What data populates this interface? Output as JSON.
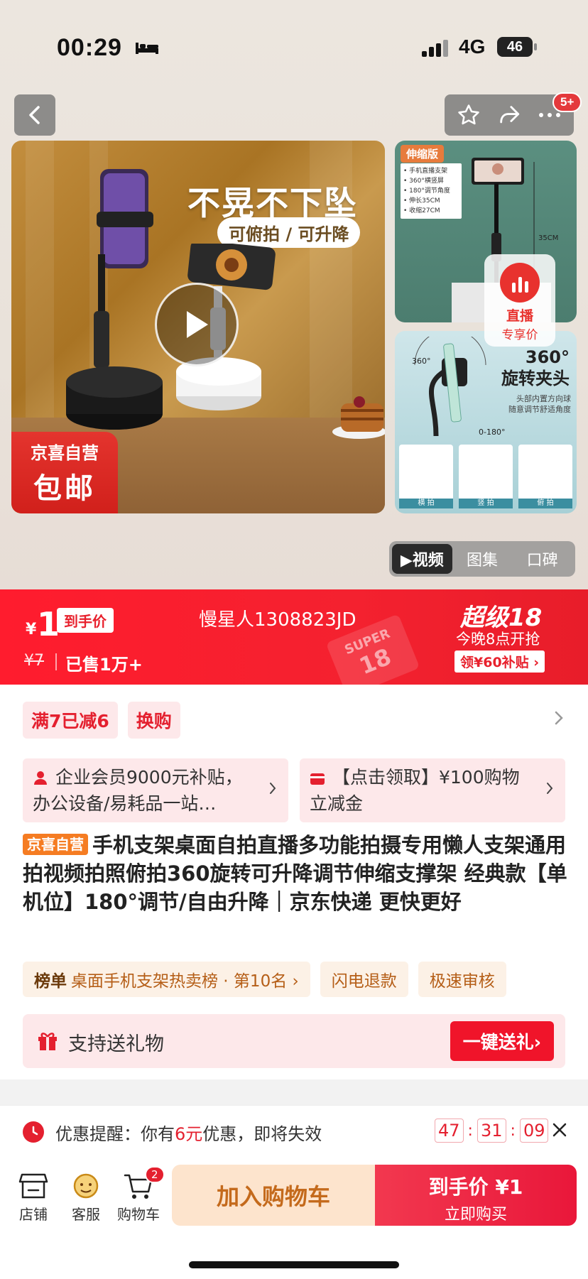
{
  "status_bar": {
    "time": "00:29",
    "network": "4G",
    "battery": "46"
  },
  "nav": {
    "badge": "5+"
  },
  "main_image": {
    "headline": "不晃不下坠",
    "subline": "可俯拍 / 可升降",
    "promo_line1": "京喜自营",
    "promo_line2": "包邮"
  },
  "thumb1": {
    "tag": "伸缩版",
    "specs": [
      "• 手机直播支架",
      "• 360°横竖屏",
      "• 180°调节角度",
      "• 伸长35CM",
      "• 收缩27CM"
    ],
    "height_label": "35CM"
  },
  "thumb2": {
    "title_line1": "360°",
    "title_line2": "旋转夹头",
    "desc_line1": "头部内置方向球",
    "desc_line2": "随意调节舒适角度",
    "angle_a": "360°",
    "angle_b": "0-180°",
    "captions": [
      "横 拍",
      "竖 拍",
      "俯 拍"
    ]
  },
  "live_chip": {
    "line1": "直播",
    "line2": "专享价"
  },
  "media_tabs": [
    {
      "label": "▶视频",
      "active": true
    },
    {
      "label": "图集",
      "active": false
    },
    {
      "label": "口碑",
      "active": false
    }
  ],
  "price": {
    "currency": "¥",
    "amount": "1",
    "final_tag": "到手价",
    "original": "¥7",
    "sold": "已售1万+",
    "store": "慢星人1308823JD",
    "super_text": "SUPER",
    "super_num": "18",
    "event_title": "超级18",
    "event_time": "今晚8点开抢",
    "subsidy": "领¥60补贴 ›"
  },
  "promos": [
    "满7已减6",
    "换购"
  ],
  "coupons": [
    {
      "text": "企业会员9000元补贴，办公设备/易耗品一站…"
    },
    {
      "text": "【点击领取】¥100购物立减金"
    }
  ],
  "product": {
    "self_tag": "京喜自营",
    "title": "手机支架桌面自拍直播多功能拍摄专用懒人支架通用拍视频拍照俯拍360旋转可升降调节伸缩支撑架 经典款【单机位】180°调节/自由升降｜京东快递 更快更好"
  },
  "rank": {
    "label": "榜单",
    "text": "桌面手机支架热卖榜 · 第10名 ›",
    "chips": [
      "闪电退款",
      "极速审核"
    ]
  },
  "gift": {
    "label": "支持送礼物",
    "button": "一键送礼›"
  },
  "reminder": {
    "prefix": "优惠提醒：你有",
    "amount": "6元",
    "suffix": "优惠，即将失效",
    "countdown": [
      "47",
      "31",
      "09"
    ]
  },
  "bottom_bar": {
    "shop": "店铺",
    "service": "客服",
    "cart": "购物车",
    "cart_count": "2",
    "add_cart": "加入购物车",
    "buy_line1": "到手价 ¥1",
    "buy_line2": "立即购买"
  },
  "colors": {
    "accent": "#f0142a",
    "promo_bg": "#fde8ea",
    "rank_bg": "#fcf1e6",
    "add_cart_bg": "#fde4cd"
  }
}
